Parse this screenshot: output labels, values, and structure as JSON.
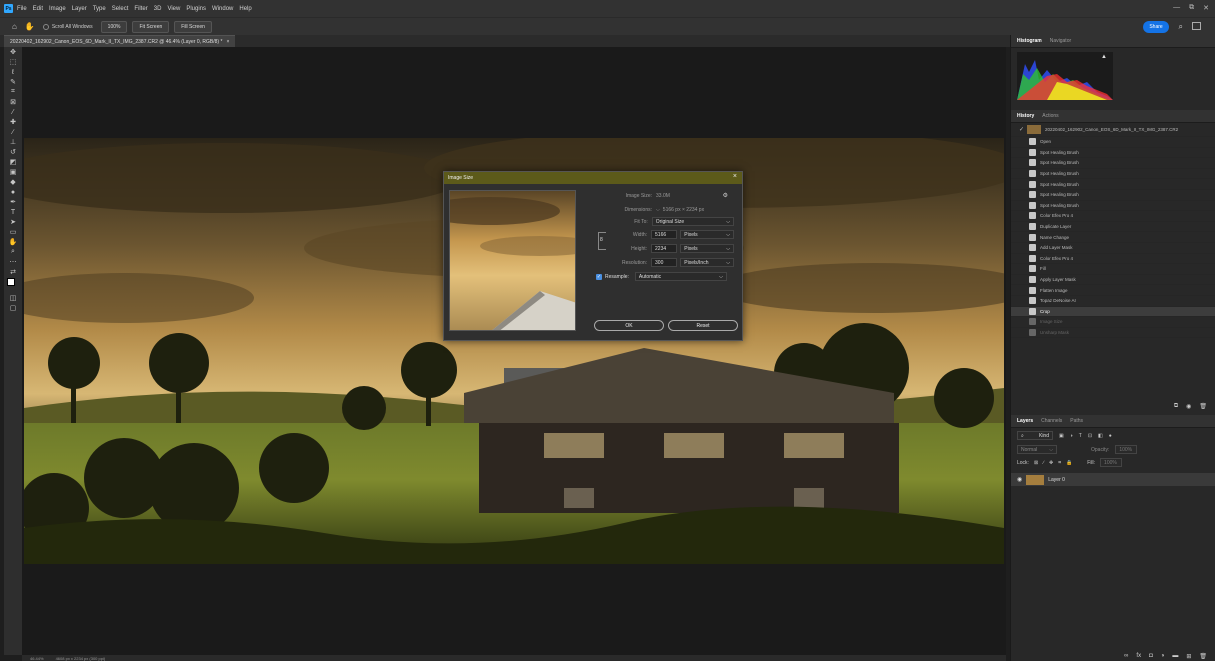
{
  "app": {
    "logo": "Ps",
    "menu": [
      "File",
      "Edit",
      "Image",
      "Layer",
      "Type",
      "Select",
      "Filter",
      "3D",
      "View",
      "Plugins",
      "Window",
      "Help"
    ],
    "window_controls": [
      "—",
      "⧉",
      "✕"
    ]
  },
  "options_bar": {
    "scroll_all_label": "Scroll All Windows",
    "zoom_label": "100%",
    "fit_screen_label": "Fit Screen",
    "fill_screen_label": "Fill Screen",
    "share_label": "Share"
  },
  "document": {
    "tab_title": "20220402_162902_Canon_EOS_6D_Mark_II_TX_IMG_2387.CR2 @ 46.4% (Layer 0, RGB/8) *"
  },
  "status_bar": {
    "zoom": "46.44%",
    "info": "4608 px x 2234 px (300 ppi)"
  },
  "dialog": {
    "title": "Image Size",
    "image_size_label": "Image Size:",
    "image_size_value": "33.0M",
    "dimensions_label": "Dimensions:",
    "dimensions_value": "5166 px  ×  2234 px",
    "fit_to_label": "Fit To:",
    "fit_to_value": "Original Size",
    "width_label": "Width:",
    "width_value": "5166",
    "width_unit": "Pixels",
    "height_label": "Height:",
    "height_value": "2234",
    "height_unit": "Pixels",
    "resolution_label": "Resolution:",
    "resolution_value": "300",
    "resolution_unit": "Pixels/Inch",
    "resample_label": "Resample:",
    "resample_value": "Automatic",
    "ok_label": "OK",
    "reset_label": "Reset"
  },
  "panels": {
    "top_tabs": [
      "Histogram",
      "Navigator"
    ],
    "history_tabs": [
      "History",
      "Actions"
    ],
    "history_snapshot": "20220402_162902_Canon_EOS_6D_Mark_II_TX_IMG_2387.CR2",
    "history_items": [
      "Open",
      "Spot Healing Brush",
      "Spot Healing Brush",
      "Spot Healing Brush",
      "Spot Healing Brush",
      "Spot Healing Brush",
      "Spot Healing Brush",
      "Color Efex Pro 4",
      "Duplicate Layer",
      "Name Change",
      "Add Layer Mask",
      "Color Efex Pro 4",
      "Fill",
      "Apply Layer Mask",
      "Flatten Image",
      "Topaz DeNoise AI",
      "Crop",
      "Image Size",
      "Unsharp Mask"
    ],
    "layers_tabs": [
      "Layers",
      "Channels",
      "Paths"
    ],
    "layers_filter": "Kind",
    "blend_mode": "Normal",
    "opacity_label": "Opacity:",
    "opacity_value": "100%",
    "lock_label": "Lock:",
    "fill_label": "Fill:",
    "fill_value": "100%",
    "layer_name": "Layer 0"
  }
}
